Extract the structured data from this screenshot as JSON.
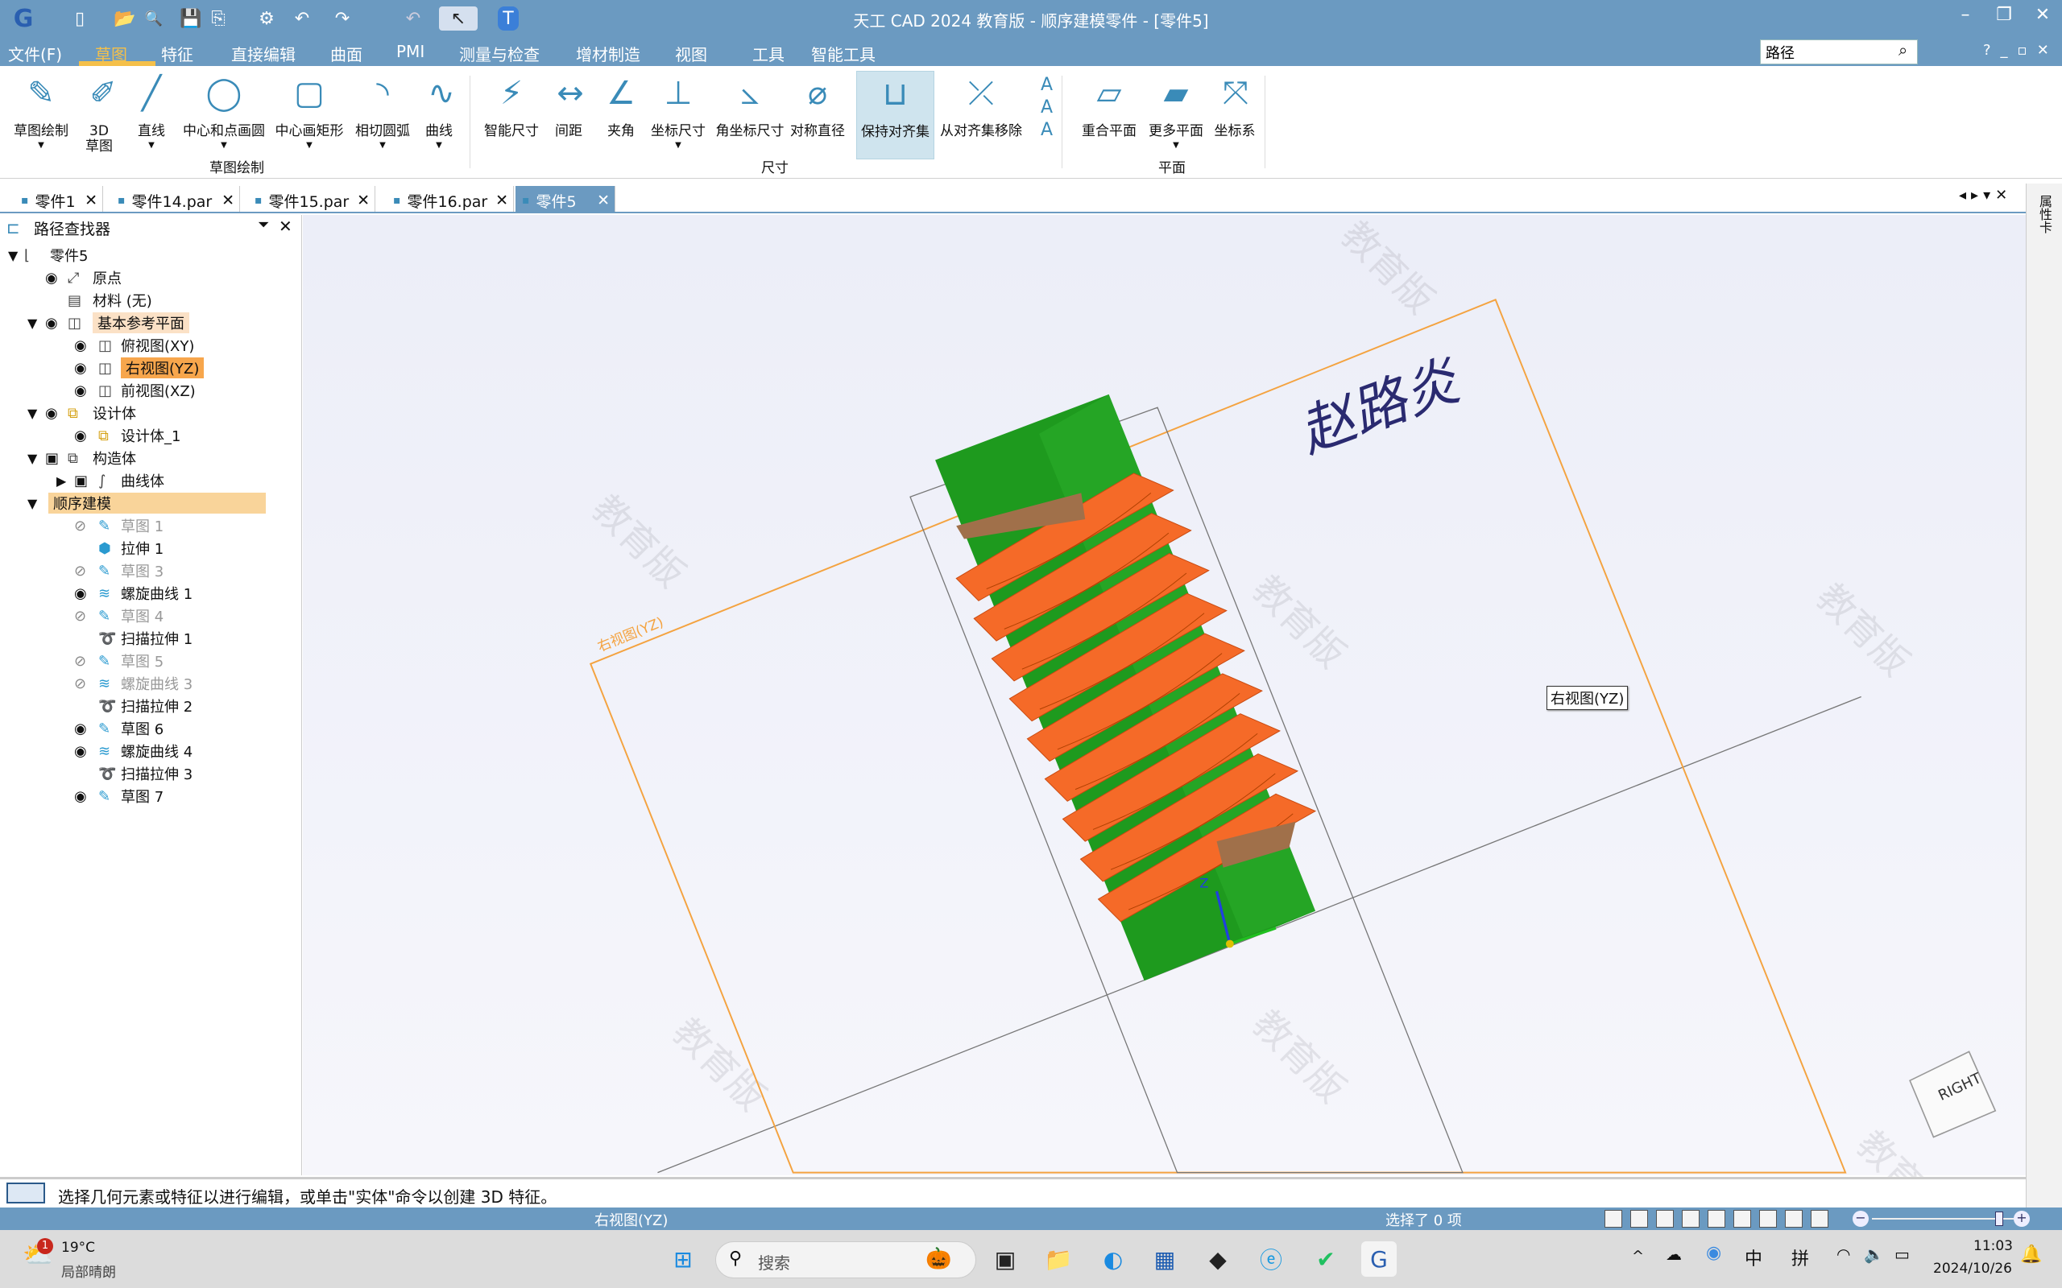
{
  "app": {
    "title": "天工 CAD 2024 教育版 - 顺序建模零件 - [零件5]",
    "logo": "tiangong-logo"
  },
  "quick_access": [
    "new-icon",
    "open-icon",
    "find-icon",
    "save-icon",
    "save-as-icon",
    "settings-icon",
    "undo-icon",
    "redo-icon",
    "back-icon",
    "select-icon",
    "t-icon"
  ],
  "window_controls": [
    "minimize",
    "restore",
    "close"
  ],
  "menu": [
    {
      "label": "文件(F)"
    },
    {
      "label": "草图",
      "active": true
    },
    {
      "label": "特征"
    },
    {
      "label": "直接编辑"
    },
    {
      "label": "曲面"
    },
    {
      "label": "PMI"
    },
    {
      "label": "测量与检查"
    },
    {
      "label": "增材制造"
    },
    {
      "label": "视图"
    },
    {
      "label": "工具"
    },
    {
      "label": "智能工具"
    }
  ],
  "search": {
    "value": "路径"
  },
  "help_controls": [
    "?",
    "_",
    "▫",
    "×"
  ],
  "ribbon": {
    "groups": [
      {
        "label": "草图绘制"
      },
      {
        "label": "尺寸"
      },
      {
        "label": "平面"
      }
    ],
    "buttons": [
      {
        "label": "草图绘制",
        "icon": "sketch-pencil-icon",
        "dropdown": true
      },
      {
        "label": "3D\n草图",
        "icon": "3d-sketch-icon"
      },
      {
        "label": "直线",
        "icon": "line-icon",
        "dropdown": true
      },
      {
        "label": "中心和点画圆",
        "icon": "circle-icon",
        "dropdown": true
      },
      {
        "label": "中心画矩形",
        "icon": "rectangle-icon",
        "dropdown": true
      },
      {
        "label": "相切圆弧",
        "icon": "arc-icon",
        "dropdown": true
      },
      {
        "label": "曲线",
        "icon": "curve-icon",
        "dropdown": true
      },
      {
        "label": "智能尺寸",
        "icon": "smart-dimension-icon"
      },
      {
        "label": "间距",
        "icon": "distance-icon"
      },
      {
        "label": "夹角",
        "icon": "angle-icon"
      },
      {
        "label": "坐标尺寸",
        "icon": "coordinate-dimension-icon",
        "dropdown": true
      },
      {
        "label": "角坐标尺寸",
        "icon": "angular-coordinate-icon"
      },
      {
        "label": "对称直径",
        "icon": "symmetric-diameter-icon"
      },
      {
        "label": "保持对齐集",
        "icon": "keep-alignment-icon",
        "active": true
      },
      {
        "label": "从对齐集移除",
        "icon": "remove-alignment-icon"
      },
      {
        "label": "重合平面",
        "icon": "coincident-plane-icon"
      },
      {
        "label": "更多平面",
        "icon": "more-planes-icon",
        "dropdown": true
      },
      {
        "label": "坐标系",
        "icon": "coordinate-system-icon"
      }
    ]
  },
  "tabs": [
    {
      "label": "零件1"
    },
    {
      "label": "零件14.par"
    },
    {
      "label": "零件15.par"
    },
    {
      "label": "零件16.par"
    },
    {
      "label": "零件5",
      "active": true
    }
  ],
  "panel": {
    "title": "路径查找器",
    "tree": [
      {
        "label": "零件5",
        "level": 0,
        "expander": "open",
        "icon": "part-icon"
      },
      {
        "label": "原点",
        "level": 1,
        "eye": "on",
        "icon": "origin-icon"
      },
      {
        "label": "材料 (无)",
        "level": 1,
        "icon": "material-icon"
      },
      {
        "label": "基本参考平面",
        "level": 1,
        "expander": "open",
        "eye": "on",
        "icon": "plane-icon",
        "highlight": "hl1"
      },
      {
        "label": "俯视图(XY)",
        "level": 2,
        "eye": "on",
        "icon": "plane-icon"
      },
      {
        "label": "右视图(YZ)",
        "level": 2,
        "eye": "on",
        "icon": "plane-icon",
        "highlight": "hl2"
      },
      {
        "label": "前视图(XZ)",
        "level": 2,
        "eye": "on",
        "icon": "plane-icon"
      },
      {
        "label": "设计体",
        "level": 1,
        "expander": "open",
        "eye": "on",
        "icon": "design-body-icon"
      },
      {
        "label": "设计体_1",
        "level": 2,
        "eye": "on",
        "icon": "design-body-icon"
      },
      {
        "label": "构造体",
        "level": 1,
        "expander": "open",
        "eye": "box",
        "icon": "construction-icon"
      },
      {
        "label": "曲线体",
        "level": 2,
        "expander": "closed",
        "eye": "box",
        "icon": "curve-body-icon"
      },
      {
        "label": "顺序建模",
        "level": 1,
        "expander": "open",
        "icon": "",
        "highlight": "hl3"
      },
      {
        "label": "草图 1",
        "level": 2,
        "eye": "off",
        "icon": "sketch-icon",
        "dim": true
      },
      {
        "label": "拉伸 1",
        "level": 2,
        "icon": "extrude-icon"
      },
      {
        "label": "草图 3",
        "level": 2,
        "eye": "off",
        "icon": "sketch-icon",
        "dim": true
      },
      {
        "label": "螺旋曲线 1",
        "level": 2,
        "eye": "on",
        "icon": "helix-icon"
      },
      {
        "label": "草图 4",
        "level": 2,
        "eye": "off",
        "icon": "sketch-icon",
        "dim": true
      },
      {
        "label": "扫描拉伸 1",
        "level": 2,
        "icon": "sweep-icon"
      },
      {
        "label": "草图 5",
        "level": 2,
        "eye": "off",
        "icon": "sketch-icon",
        "dim": true
      },
      {
        "label": "螺旋曲线 3",
        "level": 2,
        "eye": "off",
        "icon": "helix-icon",
        "dim": true
      },
      {
        "label": "扫描拉伸 2",
        "level": 2,
        "icon": "sweep-icon"
      },
      {
        "label": "草图 6",
        "level": 2,
        "eye": "on",
        "icon": "sketch-icon"
      },
      {
        "label": "螺旋曲线 4",
        "level": 2,
        "eye": "on",
        "icon": "helix-icon"
      },
      {
        "label": "扫描拉伸 3",
        "level": 2,
        "icon": "sweep-icon"
      },
      {
        "label": "草图 7",
        "level": 2,
        "eye": "on",
        "icon": "sketch-icon"
      }
    ]
  },
  "viewport": {
    "plane_label": "右视图(YZ)",
    "plane_tag": "右视图(YZ)",
    "signature": "赵路炎",
    "watermark": "教育版",
    "viewcube": "RIGHT",
    "colors": {
      "body": "#1e9a1e",
      "thread": "#f56a28",
      "plane": "#f4a340"
    }
  },
  "right_strip": {
    "label": "属性卡"
  },
  "prompt": {
    "text": "选择几何元素或特征以进行编辑，或单击\"实体\"命令以创建 3D 特征。"
  },
  "status": {
    "view": "右视图(YZ)",
    "selection": "选择了 0 项",
    "zoom_level": 0.3
  },
  "taskbar": {
    "weather_temp": "19°C",
    "weather_desc": "局部晴朗",
    "weather_badge": "1",
    "search_placeholder": "搜索",
    "ime1": "中",
    "ime2": "拼",
    "time": "11:03",
    "date": "2024/10/26",
    "apps": [
      "task-view-icon",
      "file-explorer-icon",
      "edge-icon",
      "store-icon",
      "game-icon",
      "browser-icon",
      "wechat-icon",
      "tiangong-cad-icon"
    ]
  }
}
